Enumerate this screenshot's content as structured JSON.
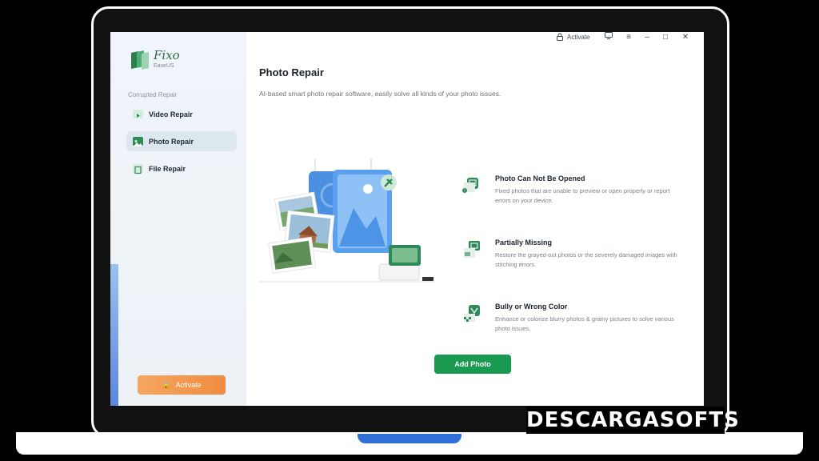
{
  "app": {
    "name": "Fixo",
    "vendor": "EaseUS"
  },
  "titlebar": {
    "activate_label": "Activate"
  },
  "sidebar": {
    "section_label": "Corrupted Repair",
    "items": [
      {
        "label": "Video Repair",
        "icon": "video-icon",
        "active": false
      },
      {
        "label": "Photo Repair",
        "icon": "photo-icon",
        "active": true
      },
      {
        "label": "File Repair",
        "icon": "file-icon",
        "active": false
      }
    ],
    "activate_label": "Activate"
  },
  "main": {
    "title": "Photo Repair",
    "subtitle": "AI-based smart photo repair software, easily solve all kinds of your photo issues.",
    "features": [
      {
        "title": "Photo Can Not Be Opened",
        "desc": "Fixed photos that are unable to preview or open properly or report errors on your device."
      },
      {
        "title": "Partially Missing",
        "desc": "Restore the grayed-out photos or the severely damaged images with stitching errors."
      },
      {
        "title": "Bully or Wrong Color",
        "desc": "Enhance or colorize blurry photos & grainy pictures to solve various photo issues."
      }
    ],
    "add_button": "Add Photo"
  },
  "watermark": "DESCARGASOFTS",
  "colors": {
    "accent_green": "#1a9a50",
    "activate_orange": "#ef8c40",
    "sidebar_bg": "#eef3f8"
  }
}
